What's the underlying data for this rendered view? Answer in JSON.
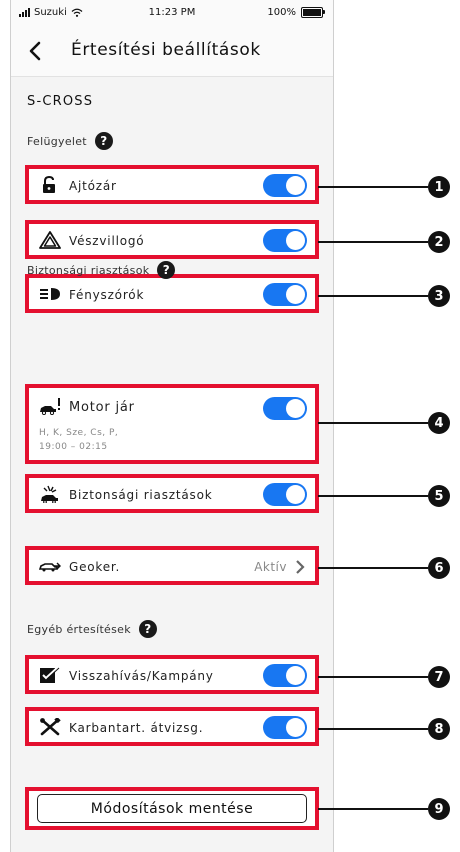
{
  "status_bar": {
    "carrier": "Suzuki",
    "time": "11:23 PM",
    "battery": "100%"
  },
  "header": {
    "title": "Értesítési beállítások"
  },
  "vehicle_name": "S-CROSS",
  "sections": {
    "supervision": {
      "label": "Felügyelet",
      "items": [
        {
          "label": "Ajtózár",
          "icon": "lock-icon",
          "enabled": true
        },
        {
          "label": "Vészvillogó",
          "icon": "hazard-icon",
          "enabled": true
        },
        {
          "label": "Fényszórók",
          "icon": "headlight-icon",
          "enabled": true
        }
      ]
    },
    "security": {
      "label": "Biztonsági riasztások",
      "engine": {
        "label": "Motor jár",
        "days": "H, K, Sze, Cs, P,",
        "time_range": "19:00 – 02:15",
        "enabled": true
      },
      "alarm": {
        "label": "Biztonsági riasztások",
        "enabled": true
      },
      "geofence": {
        "label": "Geoker.",
        "status": "Aktív"
      }
    },
    "other": {
      "label": "Egyéb értesítések",
      "items": [
        {
          "label": "Visszahívás/Kampány",
          "icon": "recall-icon",
          "enabled": true
        },
        {
          "label": "Karbantart. átvizsg.",
          "icon": "maintenance-icon",
          "enabled": true
        }
      ]
    }
  },
  "help_symbol": "?",
  "save_button": {
    "label": "Módosítások mentése"
  },
  "callouts": [
    "1",
    "2",
    "3",
    "4",
    "5",
    "6",
    "7",
    "8",
    "9"
  ],
  "colors": {
    "highlight": "#e4102f",
    "toggle_on": "#1877f2",
    "callout": "#111111"
  }
}
